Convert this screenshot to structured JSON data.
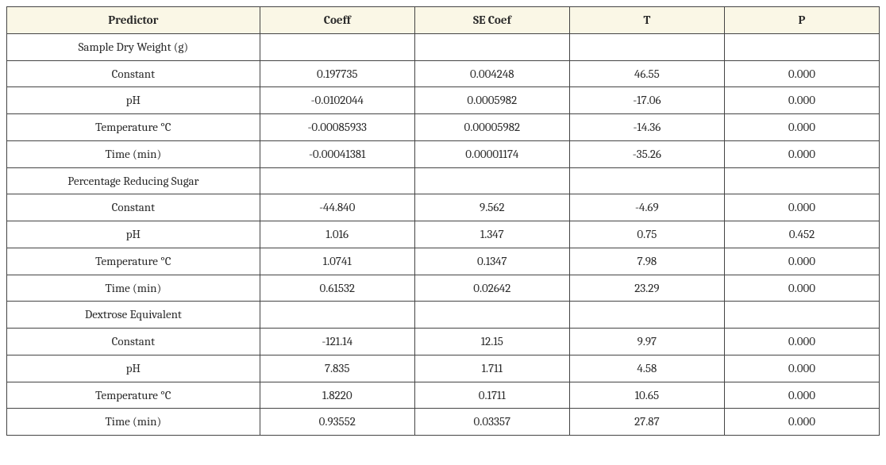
{
  "table": {
    "headers": {
      "predictor": "Predictor",
      "coeff": "Coeff",
      "se_coef": "SE Coef",
      "t": "T",
      "p": "P"
    },
    "sections": [
      {
        "title": "Sample Dry Weight (g)",
        "rows": [
          {
            "predictor": "Constant",
            "coeff": "0.197735",
            "se_coef": "0.004248",
            "t": "46.55",
            "p": "0.000"
          },
          {
            "predictor": "pH",
            "coeff": "-0.0102044",
            "se_coef": "0.0005982",
            "t": "-17.06",
            "p": "0.000"
          },
          {
            "predictor": "Temperature °C",
            "coeff": "-0.00085933",
            "se_coef": "0.00005982",
            "t": "-14.36",
            "p": "0.000"
          },
          {
            "predictor": "Time (min)",
            "coeff": "-0.00041381",
            "se_coef": "0.00001174",
            "t": "-35.26",
            "p": "0.000"
          }
        ]
      },
      {
        "title": "Percentage Reducing Sugar",
        "rows": [
          {
            "predictor": "Constant",
            "coeff": "-44.840",
            "se_coef": "9.562",
            "t": "-4.69",
            "p": "0.000"
          },
          {
            "predictor": "pH",
            "coeff": "1.016",
            "se_coef": "1.347",
            "t": "0.75",
            "p": "0.452"
          },
          {
            "predictor": "Temperature °C",
            "coeff": "1.0741",
            "se_coef": "0.1347",
            "t": "7.98",
            "p": "0.000"
          },
          {
            "predictor": "Time (min)",
            "coeff": "0.61532",
            "se_coef": "0.02642",
            "t": "23.29",
            "p": "0.000"
          }
        ]
      },
      {
        "title": "Dextrose Equivalent",
        "rows": [
          {
            "predictor": "Constant",
            "coeff": "-121.14",
            "se_coef": "12.15",
            "t": "9.97",
            "p": "0.000"
          },
          {
            "predictor": "pH",
            "coeff": "7.835",
            "se_coef": "1.711",
            "t": "4.58",
            "p": "0.000"
          },
          {
            "predictor": "Temperature °C",
            "coeff": "1.8220",
            "se_coef": "0.1711",
            "t": "10.65",
            "p": "0.000"
          },
          {
            "predictor": "Time (min)",
            "coeff": "0.93552",
            "se_coef": "0.03357",
            "t": "27.87",
            "p": "0.000"
          }
        ]
      }
    ]
  }
}
